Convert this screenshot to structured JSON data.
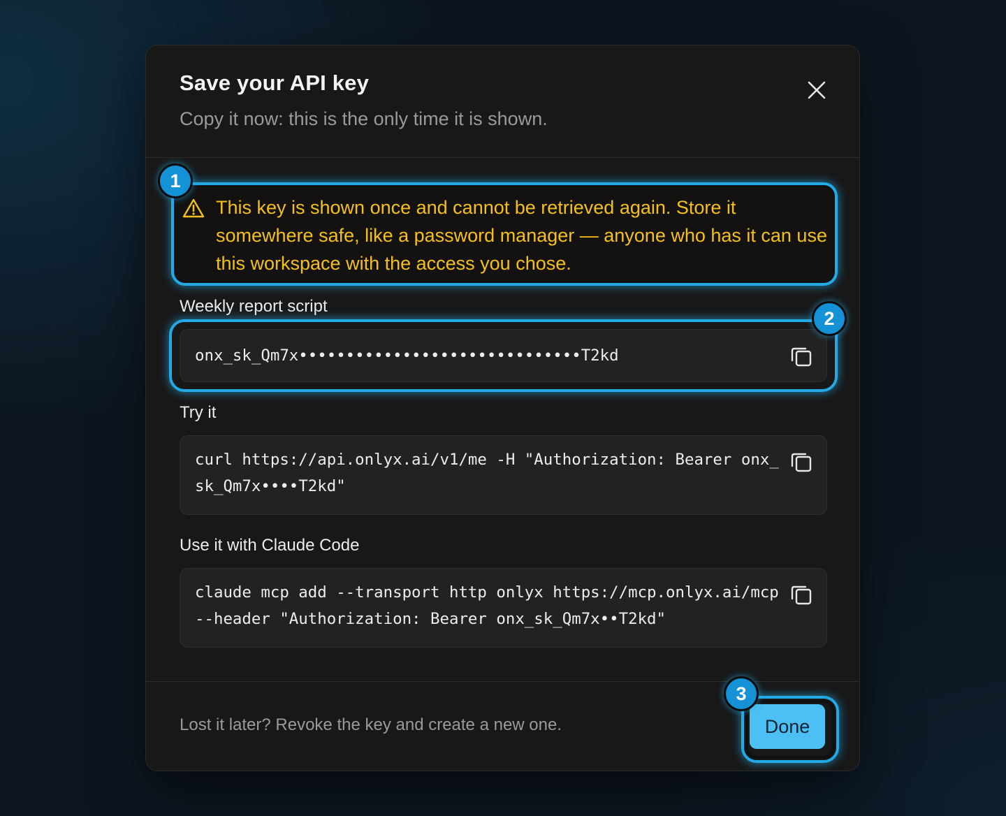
{
  "dialog": {
    "title": "Save your API key",
    "subtitle": "Copy it now: this is the only time it is shown."
  },
  "warning": {
    "icon": "warning-triangle-icon",
    "text": "This key is shown once and cannot be retrieved again. Store it somewhere safe, like a password manager — anyone who has it can use this workspace with the access you chose."
  },
  "key": {
    "label": "Weekly report script",
    "value": "onx_sk_Qm7x••••••••••••••••••••••••••••••T2kd"
  },
  "try_it": {
    "label": "Try it",
    "command": "curl https://api.onlyx.ai/v1/me -H \"Authorization: Bearer onx_sk_Qm7x••••T2kd\""
  },
  "claude_code": {
    "label": "Use it with Claude Code",
    "command": "claude mcp add --transport http onlyx https://mcp.onlyx.ai/mcp --header \"Authorization: Bearer onx_sk_Qm7x••T2kd\""
  },
  "footer": {
    "note": "Lost it later? Revoke the key and create a new one.",
    "done_label": "Done"
  },
  "steps": [
    "1",
    "2",
    "3"
  ],
  "colors": {
    "accent_highlight": "#23a9e6",
    "warning_text": "#f4c01e",
    "done_button": "#4cc0f5",
    "badge": "#1591d6"
  }
}
